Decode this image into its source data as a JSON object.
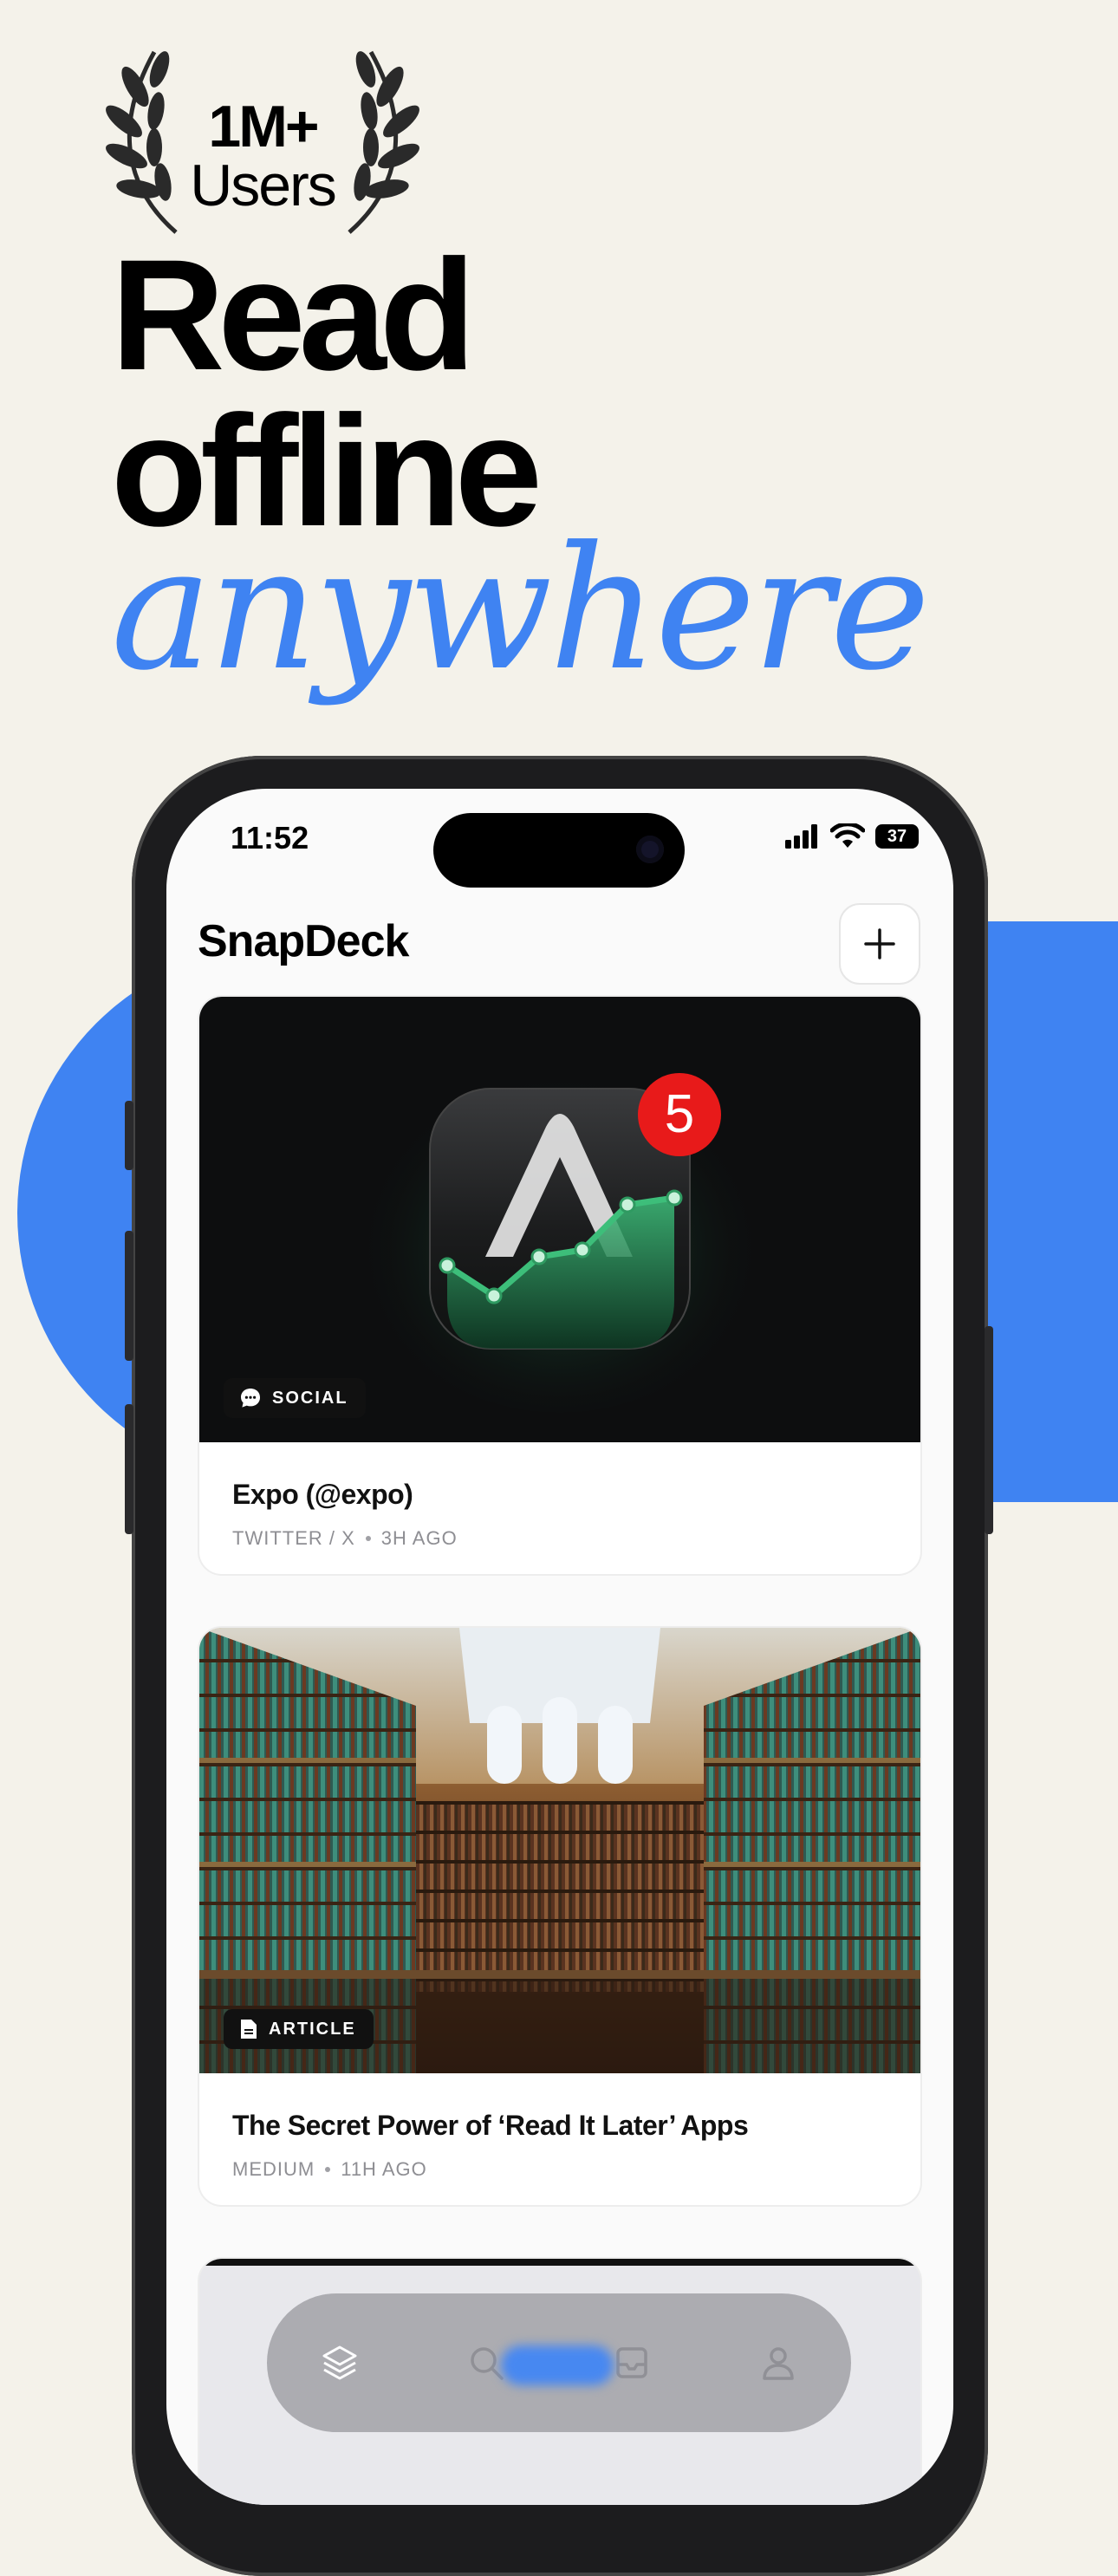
{
  "badge": {
    "line1": "1M+",
    "line2": "Users"
  },
  "headline": {
    "line1": "Read",
    "line2": "offline",
    "line3": "anywhere"
  },
  "colors": {
    "accent": "#3F83F2",
    "background": "#F4F2EA",
    "notification": "#E81A1A",
    "chart_green": "#3DBE7A"
  },
  "status_bar": {
    "time": "11:52",
    "battery": "37",
    "icons": [
      "signal-icon",
      "wifi-icon",
      "battery-icon"
    ]
  },
  "app": {
    "title": "SnapDeck",
    "add_icon": "plus-icon"
  },
  "cards": [
    {
      "tag": "SOCIAL",
      "tag_icon": "chat-bubble-icon",
      "title": "Expo (@expo)",
      "source": "TWITTER / X",
      "time": "3H AGO",
      "badge_count": "5",
      "image": "app-icon-chart"
    },
    {
      "tag": "ARTICLE",
      "tag_icon": "document-icon",
      "title": "The Secret Power of ‘Read It Later’ Apps",
      "source": "MEDIUM",
      "time": "11H AGO",
      "image": "library-interior"
    }
  ],
  "tabbar": {
    "items": [
      "layers-icon",
      "search-icon",
      "inbox-icon",
      "profile-icon"
    ]
  }
}
